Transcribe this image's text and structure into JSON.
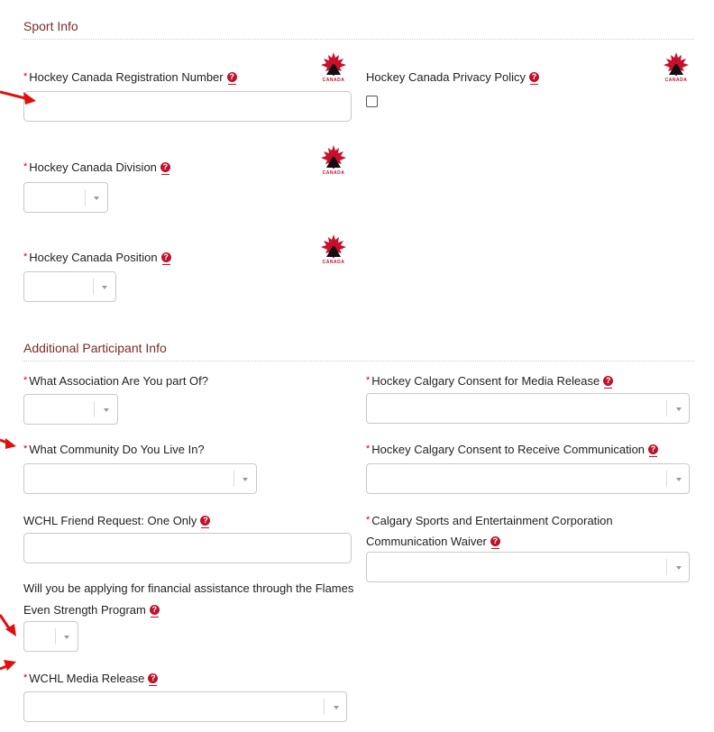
{
  "sport_info": {
    "title": "Sport Info",
    "logo_text": "CANADA",
    "registration_number": {
      "label": "Hockey Canada Registration Number",
      "required": "*"
    },
    "privacy_policy": {
      "label": "Hockey Canada Privacy Policy"
    },
    "division": {
      "label": "Hockey Canada Division",
      "required": "*"
    },
    "position": {
      "label": "Hockey Canada Position",
      "required": "*"
    }
  },
  "additional": {
    "title": "Additional Participant Info",
    "association": {
      "label": "What Association Are You part Of?",
      "required": "*"
    },
    "community": {
      "label": "What Community Do You Live In?",
      "required": "*"
    },
    "friend_request": {
      "label": "WCHL Friend Request: One Only"
    },
    "financial": {
      "label_line1": "Will you be applying for financial assistance through the Flames",
      "label_line2": "Even Strength Program"
    },
    "media_release": {
      "label": "WCHL Media Release",
      "required": "*"
    },
    "consent_media": {
      "label": "Hockey Calgary Consent for Media Release",
      "required": "*"
    },
    "consent_comm": {
      "label": "Hockey Calgary Consent to Receive Communication",
      "required": "*"
    },
    "csec_waiver": {
      "label_line1": "Calgary Sports and Entertainment Corporation",
      "label_line2": "Communication Waiver",
      "required": "*"
    }
  },
  "colors": {
    "section_title": "#7a2b2b",
    "required": "#d0021b",
    "help_icon": "#c0102a",
    "arrow": "#e01010",
    "logo": "#c8102e"
  }
}
